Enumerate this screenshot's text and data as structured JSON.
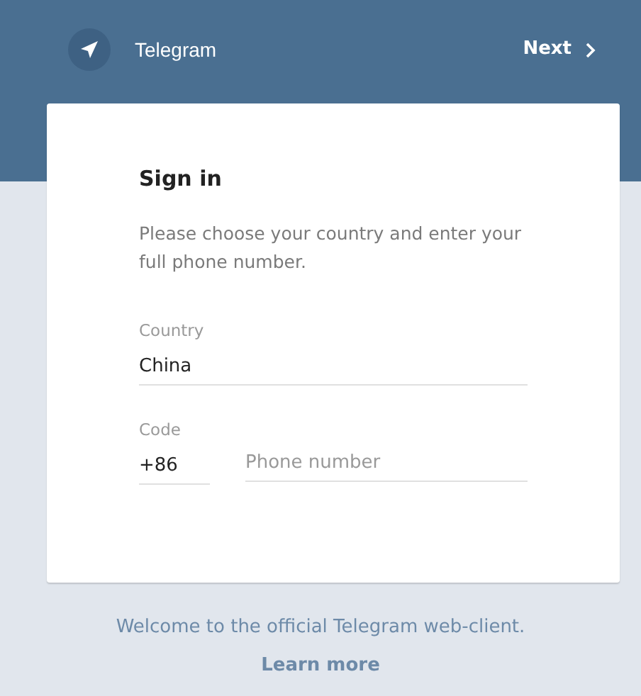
{
  "header": {
    "title": "Telegram",
    "next_button": "Next"
  },
  "card": {
    "title": "Sign in",
    "description": "Please choose your country and enter your full phone number.",
    "country": {
      "label": "Country",
      "value": "China"
    },
    "code": {
      "label": "Code",
      "value": "+86"
    },
    "phone": {
      "placeholder": "Phone number"
    }
  },
  "footer": {
    "welcome": "Welcome to the official Telegram web-client.",
    "link": "Learn more"
  }
}
